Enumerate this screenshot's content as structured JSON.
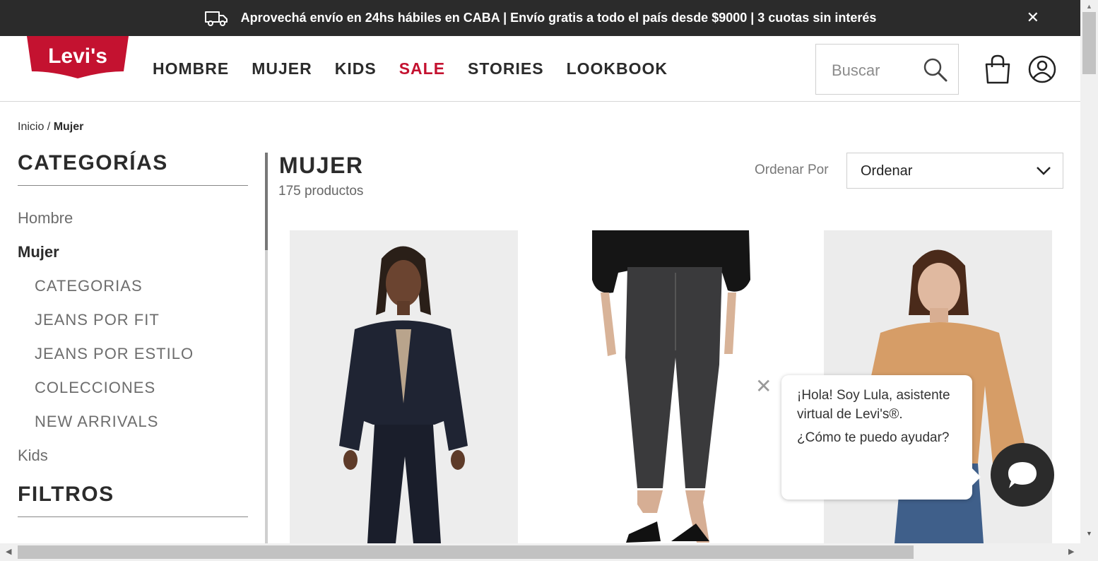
{
  "promo": {
    "text": "Aprovechá envío en 24hs hábiles en CABA | Envío gratis a todo el país desde $9000 | 3 cuotas sin interés",
    "icon": "truck-icon",
    "close_icon": "close-icon"
  },
  "header": {
    "logo_text": "Levi's",
    "nav": [
      "HOMBRE",
      "MUJER",
      "KIDS",
      "SALE",
      "STORIES",
      "LOOKBOOK"
    ],
    "search_placeholder": "Buscar",
    "colors": {
      "sale": "#c41230",
      "brand_red": "#c41230",
      "bar": "#2b2b2b"
    }
  },
  "breadcrumb": {
    "home": "Inicio",
    "separator": " / ",
    "current": "Mujer"
  },
  "sidebar": {
    "title": "CATEGORÍAS",
    "items": [
      {
        "label": "Hombre"
      },
      {
        "label": "Mujer"
      },
      {
        "label": "CATEGORIAS"
      },
      {
        "label": "JEANS POR FIT"
      },
      {
        "label": "JEANS POR ESTILO"
      },
      {
        "label": "COLECCIONES"
      },
      {
        "label": "NEW ARRIVALS"
      },
      {
        "label": "Kids"
      }
    ],
    "filters_title": "FILTROS"
  },
  "main": {
    "title": "MUJER",
    "count": "175 productos",
    "sort_label": "Ordenar Por",
    "sort_value": "Ordenar"
  },
  "chat": {
    "line1": "¡Hola! Soy Lula, asistente virtual de Levi's®.",
    "line2": "¿Cómo te puedo ayudar?"
  }
}
